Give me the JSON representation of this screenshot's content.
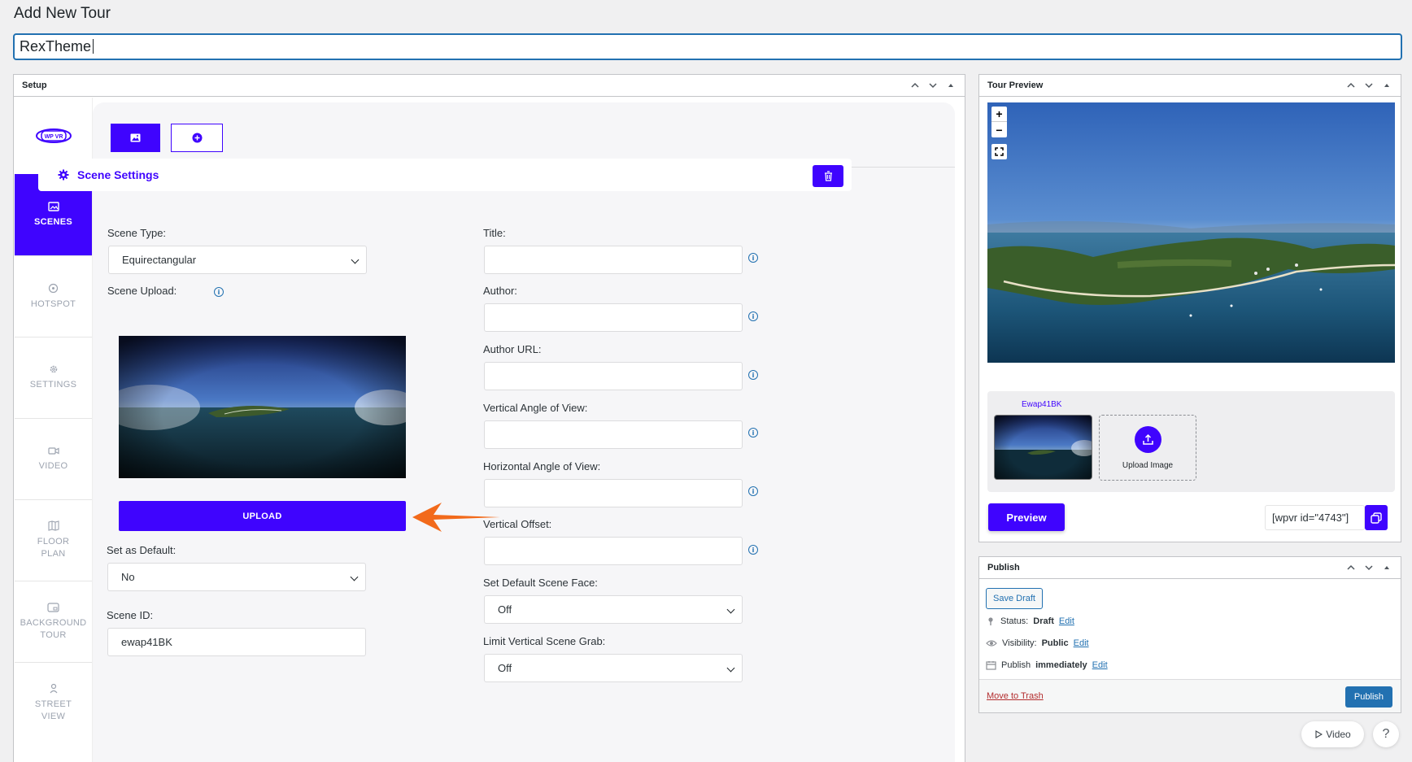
{
  "page": {
    "title": "Add New Tour",
    "tour_name": "RexTheme"
  },
  "setup": {
    "header": "Setup",
    "logo_text": "WP VR",
    "sidebar": [
      {
        "label": "SCENES",
        "icon": "image-icon",
        "active": true
      },
      {
        "label": "HOTSPOT",
        "icon": "target-icon"
      },
      {
        "label": "SETTINGS",
        "icon": "gear-icon"
      },
      {
        "label": "VIDEO",
        "icon": "video-icon"
      },
      {
        "label": "FLOOR PLAN",
        "icon": "map-icon"
      },
      {
        "label": "BACKGROUND TOUR",
        "icon": "picture-icon"
      },
      {
        "label": "STREET VIEW",
        "icon": "person-icon"
      }
    ],
    "scene_settings_title": "Scene Settings",
    "left": {
      "scene_type_label": "Scene Type:",
      "scene_type_value": "Equirectangular",
      "scene_upload_label": "Scene Upload:",
      "upload_button": "UPLOAD",
      "set_default_label": "Set as Default:",
      "set_default_value": "No",
      "scene_id_label": "Scene ID:",
      "scene_id_value": "ewap41BK"
    },
    "right": {
      "title_label": "Title:",
      "author_label": "Author:",
      "author_url_label": "Author URL:",
      "vertical_angle_label": "Vertical Angle of View:",
      "horizontal_angle_label": "Horizontal Angle of View:",
      "vertical_offset_label": "Vertical Offset:",
      "default_face_label": "Set Default Scene Face:",
      "default_face_value": "Off",
      "limit_grab_label": "Limit Vertical Scene Grab:",
      "limit_grab_value": "Off"
    }
  },
  "tour_preview": {
    "header": "Tour Preview",
    "zoom_in": "+",
    "zoom_out": "−",
    "scene_name": "Ewap41BK",
    "upload_image": "Upload Image",
    "preview_button": "Preview",
    "shortcode": "[wpvr id=\"4743\"]"
  },
  "publish": {
    "header": "Publish",
    "save_draft": "Save Draft",
    "status_label": "Status:",
    "status_value": "Draft",
    "visibility_label": "Visibility:",
    "visibility_value": "Public",
    "publish_label": "Publish",
    "publish_value": "immediately",
    "edit": "Edit",
    "move_to_trash": "Move to Trash",
    "publish_button": "Publish"
  },
  "floating": {
    "video": "Video",
    "help": "?"
  },
  "colors": {
    "accent": "#3f04fe",
    "wp_blue": "#2271b1",
    "arrow": "#f26a1b"
  }
}
